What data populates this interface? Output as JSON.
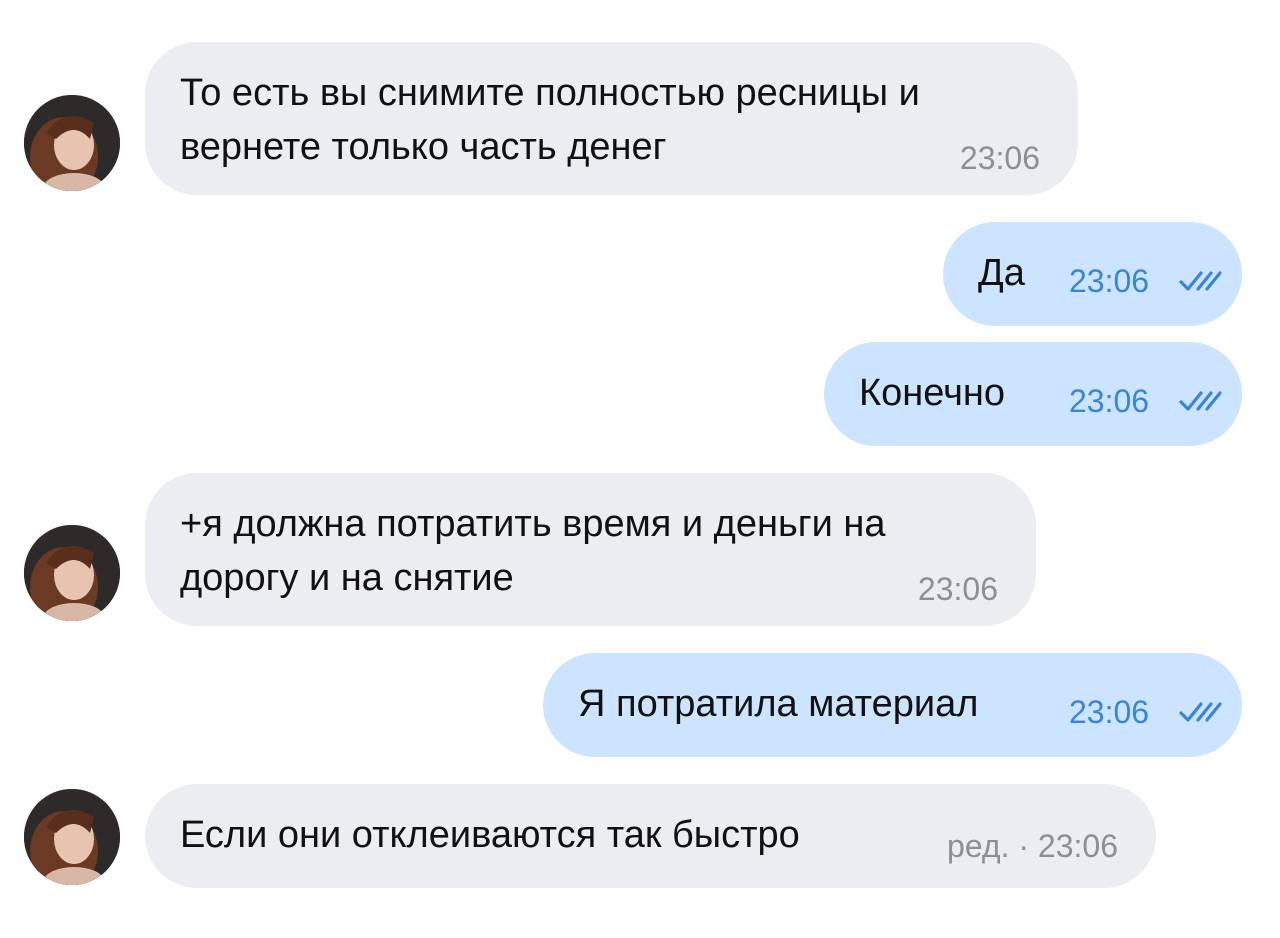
{
  "colors": {
    "incoming_bubble": "#ebedf0",
    "outgoing_bubble": "#cce4ff",
    "outgoing_meta": "#3a84d6",
    "incoming_meta": "#8c8f94"
  },
  "messages": [
    {
      "direction": "incoming",
      "text_lines": [
        "То есть вы снимите полностью ресницы и",
        "вернете только часть денег"
      ],
      "time": "23:06",
      "has_avatar": true
    },
    {
      "direction": "outgoing",
      "text_lines": [
        "Да"
      ],
      "time": "23:06",
      "status_icon": "double-check-icon"
    },
    {
      "direction": "outgoing",
      "text_lines": [
        "Конечно"
      ],
      "time": "23:06",
      "status_icon": "double-check-icon"
    },
    {
      "direction": "incoming",
      "text_lines": [
        "+я должна потратить время и деньги на",
        "дорогу и на снятие"
      ],
      "time": "23:06",
      "has_avatar": true
    },
    {
      "direction": "outgoing",
      "text_lines": [
        "Я потратила материал"
      ],
      "time": "23:06",
      "status_icon": "double-check-icon"
    },
    {
      "direction": "incoming",
      "text_lines": [
        "Если они отклеиваются так быстро"
      ],
      "time": "ред. · 23:06",
      "has_avatar": true
    }
  ]
}
